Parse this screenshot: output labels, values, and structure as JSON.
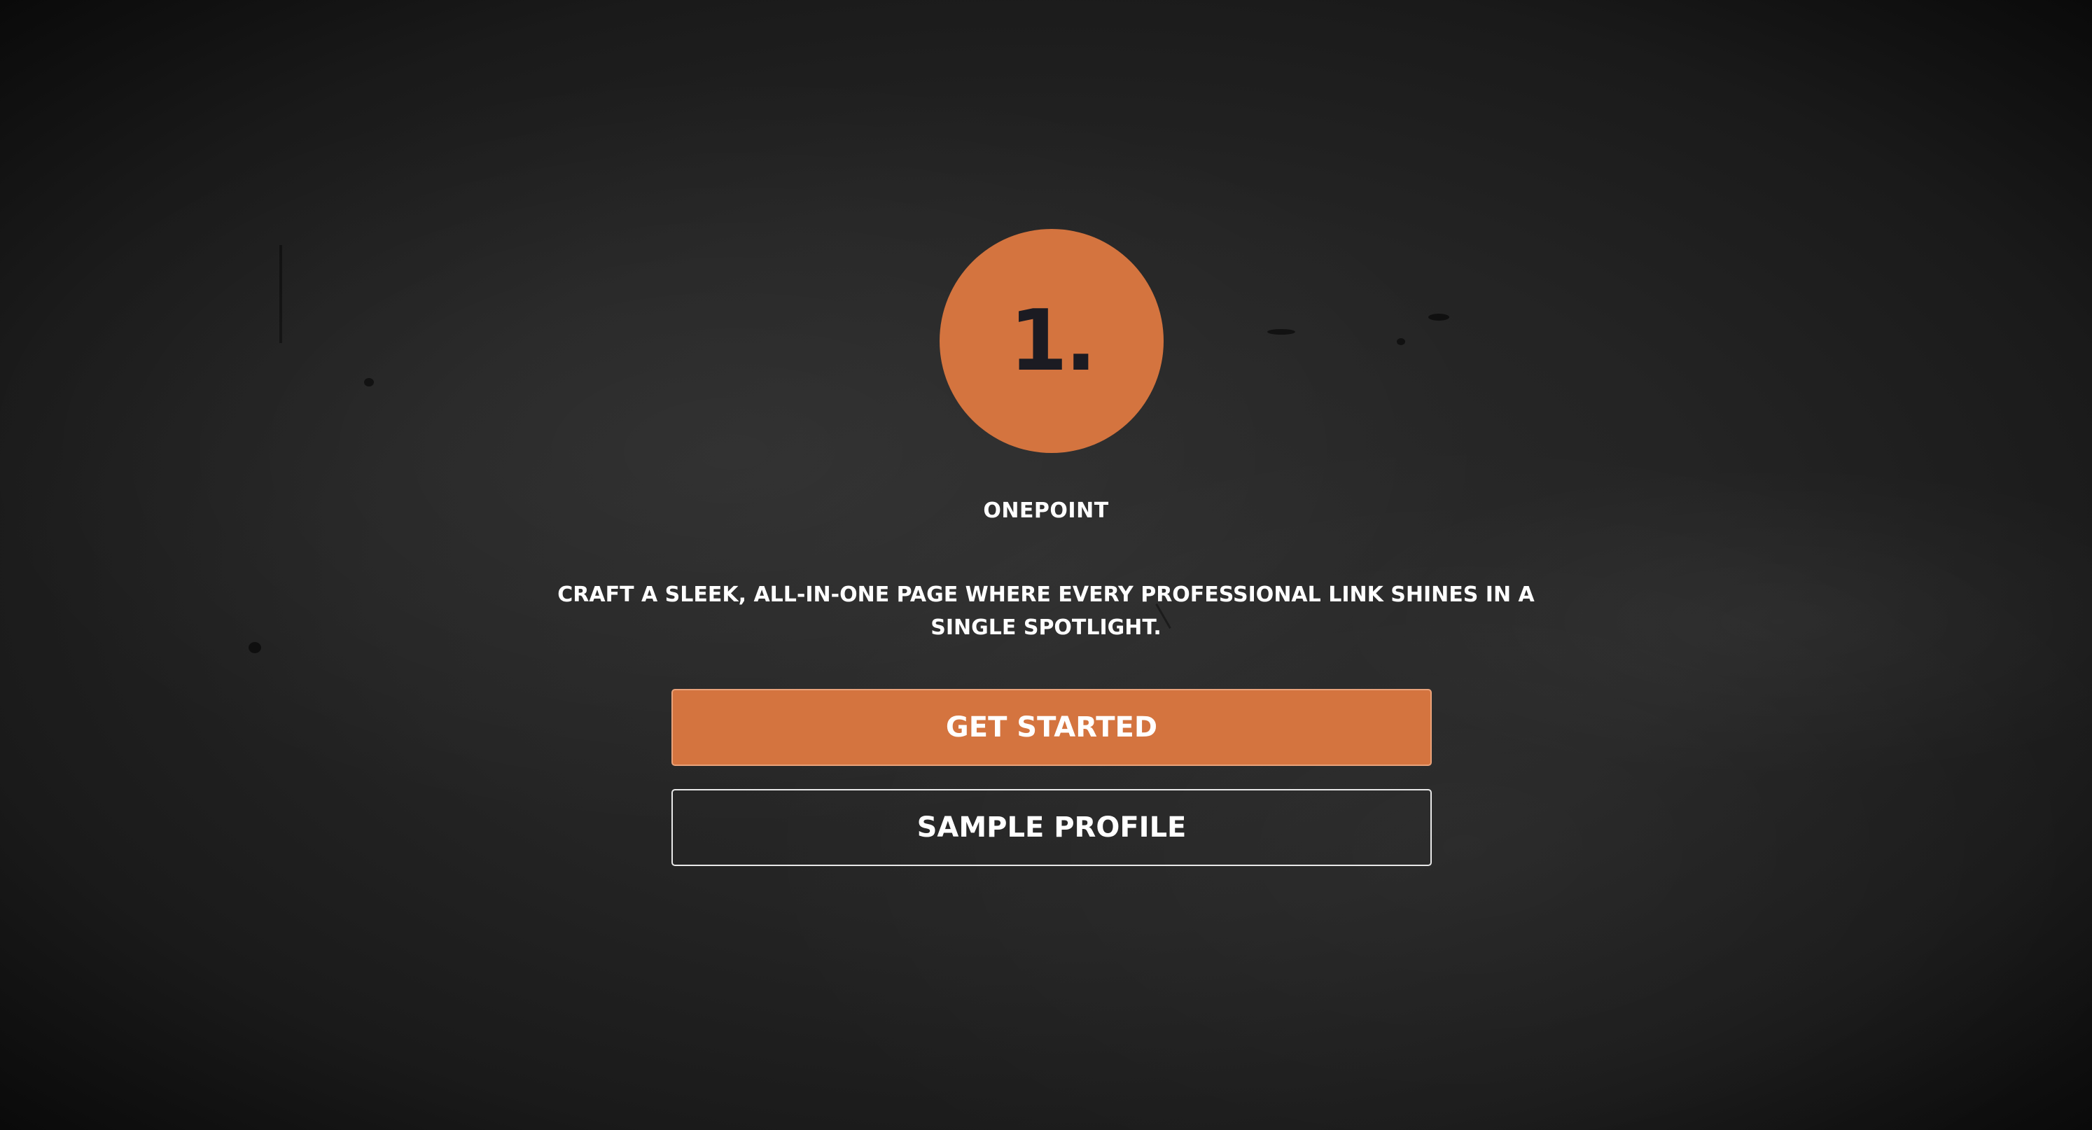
{
  "theme": {
    "accent_color": "#d4743f",
    "text_color": "#ffffff",
    "logo_text_color": "#1b1b22"
  },
  "logo": {
    "text": "1."
  },
  "brand": {
    "name": "ONEPOINT"
  },
  "hero": {
    "tagline": "CRAFT A SLEEK, ALL-IN-ONE PAGE WHERE EVERY PROFESSIONAL LINK SHINES IN A SINGLE SPOTLIGHT."
  },
  "actions": {
    "primary_label": "GET STARTED",
    "secondary_label": "SAMPLE PROFILE"
  }
}
